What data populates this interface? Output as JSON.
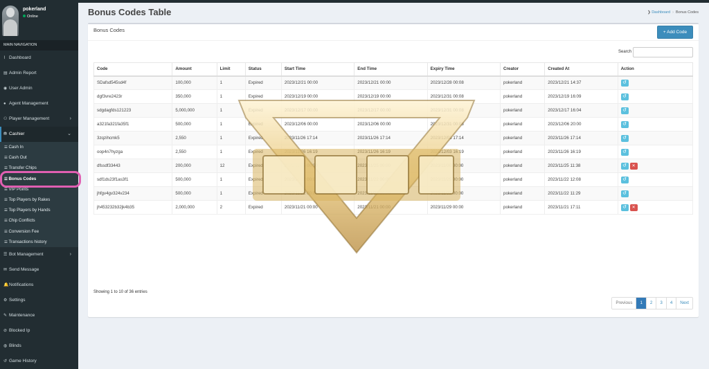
{
  "user": {
    "name": "pokerland",
    "status": "Online"
  },
  "nav": {
    "header": "MAIN NAVIGATION",
    "items": [
      {
        "label": "Dashboard",
        "icon": "chart-line-icon",
        "glyph": "⌇"
      },
      {
        "label": "Admin Report",
        "icon": "chart-bar-icon",
        "glyph": "▤"
      },
      {
        "label": "User Admin",
        "icon": "user-circle-icon",
        "glyph": "◉"
      },
      {
        "label": "Agent Management",
        "icon": "user-icon",
        "glyph": "●"
      },
      {
        "label": "Player Management",
        "icon": "users-icon",
        "glyph": "⚇"
      },
      {
        "label": "Cashier",
        "icon": "coins-icon",
        "glyph": "⛃"
      }
    ],
    "cashier_sub": [
      "Cash In",
      "Cash Out",
      "Transfer Chips",
      "Bonus Codes",
      "VIP Points",
      "Top Players by Rakes",
      "Top Players by Hands",
      "Chip Conflicts",
      "Conversion Fee",
      "Transactions history"
    ],
    "items_after": [
      {
        "label": "Bot Management",
        "icon": "list-icon",
        "glyph": "☰"
      },
      {
        "label": "Send Message",
        "icon": "envelope-icon",
        "glyph": "✉"
      },
      {
        "label": "Notifications",
        "icon": "bell-icon",
        "glyph": "🔔"
      },
      {
        "label": "Settings",
        "icon": "gear-icon",
        "glyph": "⚙"
      },
      {
        "label": "Maintenance",
        "icon": "wrench-icon",
        "glyph": "✎"
      },
      {
        "label": "Blocked Ip",
        "icon": "blocked-icon",
        "glyph": "⊘"
      },
      {
        "label": "Blinds",
        "icon": "database-icon",
        "glyph": "◍"
      },
      {
        "label": "Game History",
        "icon": "history-icon",
        "glyph": "↺"
      }
    ]
  },
  "page": {
    "title": "Bonus Codes Table"
  },
  "breadcrumb": {
    "home": "Dashboard",
    "current": "Bonus Codes"
  },
  "box": {
    "title": "Bonus Codes",
    "add_label": "+ Add Code",
    "search_label": "Search"
  },
  "table": {
    "headers": [
      "Code",
      "Amount",
      "Limit",
      "Status",
      "Start Time",
      "End Time",
      "Expiry Time",
      "Creator",
      "Created At",
      "Action"
    ],
    "rows": [
      [
        "SDafsd545sd4f",
        "100,000",
        "1",
        "Expired",
        "2023/12/21  00:00",
        "2023/12/21  00:00",
        "2023/12/28  00:08",
        "pokerland",
        "2023/12/21  14:37",
        "r"
      ],
      [
        "dgf3vre2423r",
        "350,000",
        "1",
        "Expired",
        "2023/12/19  00:00",
        "2023/12/19  00:00",
        "2023/12/31  00:08",
        "pokerland",
        "2023/12/19  16:09",
        "r"
      ],
      [
        "sdgdagfds121223",
        "5,000,000",
        "1",
        "Expired",
        "2023/12/17  00:00",
        "2023/12/17  00:00",
        "2023/12/31  00:08",
        "pokerland",
        "2023/12/17  16:04",
        "r"
      ],
      [
        "a321fa321fa35f1",
        "500,000",
        "1",
        "Expired",
        "2023/12/06  00:00",
        "2023/12/06  00:00",
        "2023/12/31  00:08",
        "pokerland",
        "2023/12/06  20:00",
        "r"
      ],
      [
        "3zqzihcmk5",
        "2,550",
        "1",
        "Expired",
        "2023/11/26  17:14",
        "2023/11/26  17:14",
        "2023/12/03  17:14",
        "pokerland",
        "2023/11/26  17:14",
        "r"
      ],
      [
        "oop4n7hyzga",
        "2,550",
        "1",
        "Expired",
        "2023/11/26  16:19",
        "2023/11/26  16:19",
        "2023/12/03  16:19",
        "pokerland",
        "2023/11/26  16:19",
        "r"
      ],
      [
        "dfssdf33443",
        "200,000",
        "12",
        "Expired",
        "2023/11/25  00:00",
        "2023/11/25  00:00",
        "2023/11/30  00:00",
        "pokerland",
        "2023/11/25  11:38",
        "rd"
      ],
      [
        "sdf1ds23f1as3f1",
        "500,000",
        "1",
        "Expired",
        "2023/11/22  00:00",
        "2023/11/22  00:00",
        "2023/11/25  00:00",
        "pokerland",
        "2023/11/22  12:08",
        "r"
      ],
      [
        "jhfgv4gv324v234",
        "500,000",
        "1",
        "Expired",
        "2023/11/22  00:00",
        "2023/11/22  00:00",
        "2023/11/23  00:00",
        "pokerland",
        "2023/11/22  11:29",
        "r"
      ],
      [
        "jh453232b32jk4b35",
        "2,000,000",
        "2",
        "Expired",
        "2023/11/21  00:00",
        "2023/11/21  00:00",
        "2023/11/29  00:00",
        "pokerland",
        "2023/11/21  17:11",
        "rd"
      ]
    ]
  },
  "footer": {
    "showing": "Showing 1 to 10 of 36 entries"
  },
  "pagination": [
    "Previous",
    "1",
    "2",
    "3",
    "4",
    "Next"
  ],
  "colors": {
    "sidebar": "#222d32",
    "primary": "#3c8dbc",
    "info": "#5bc0de",
    "danger": "#d9534f",
    "highlight": "#e05fb2"
  }
}
